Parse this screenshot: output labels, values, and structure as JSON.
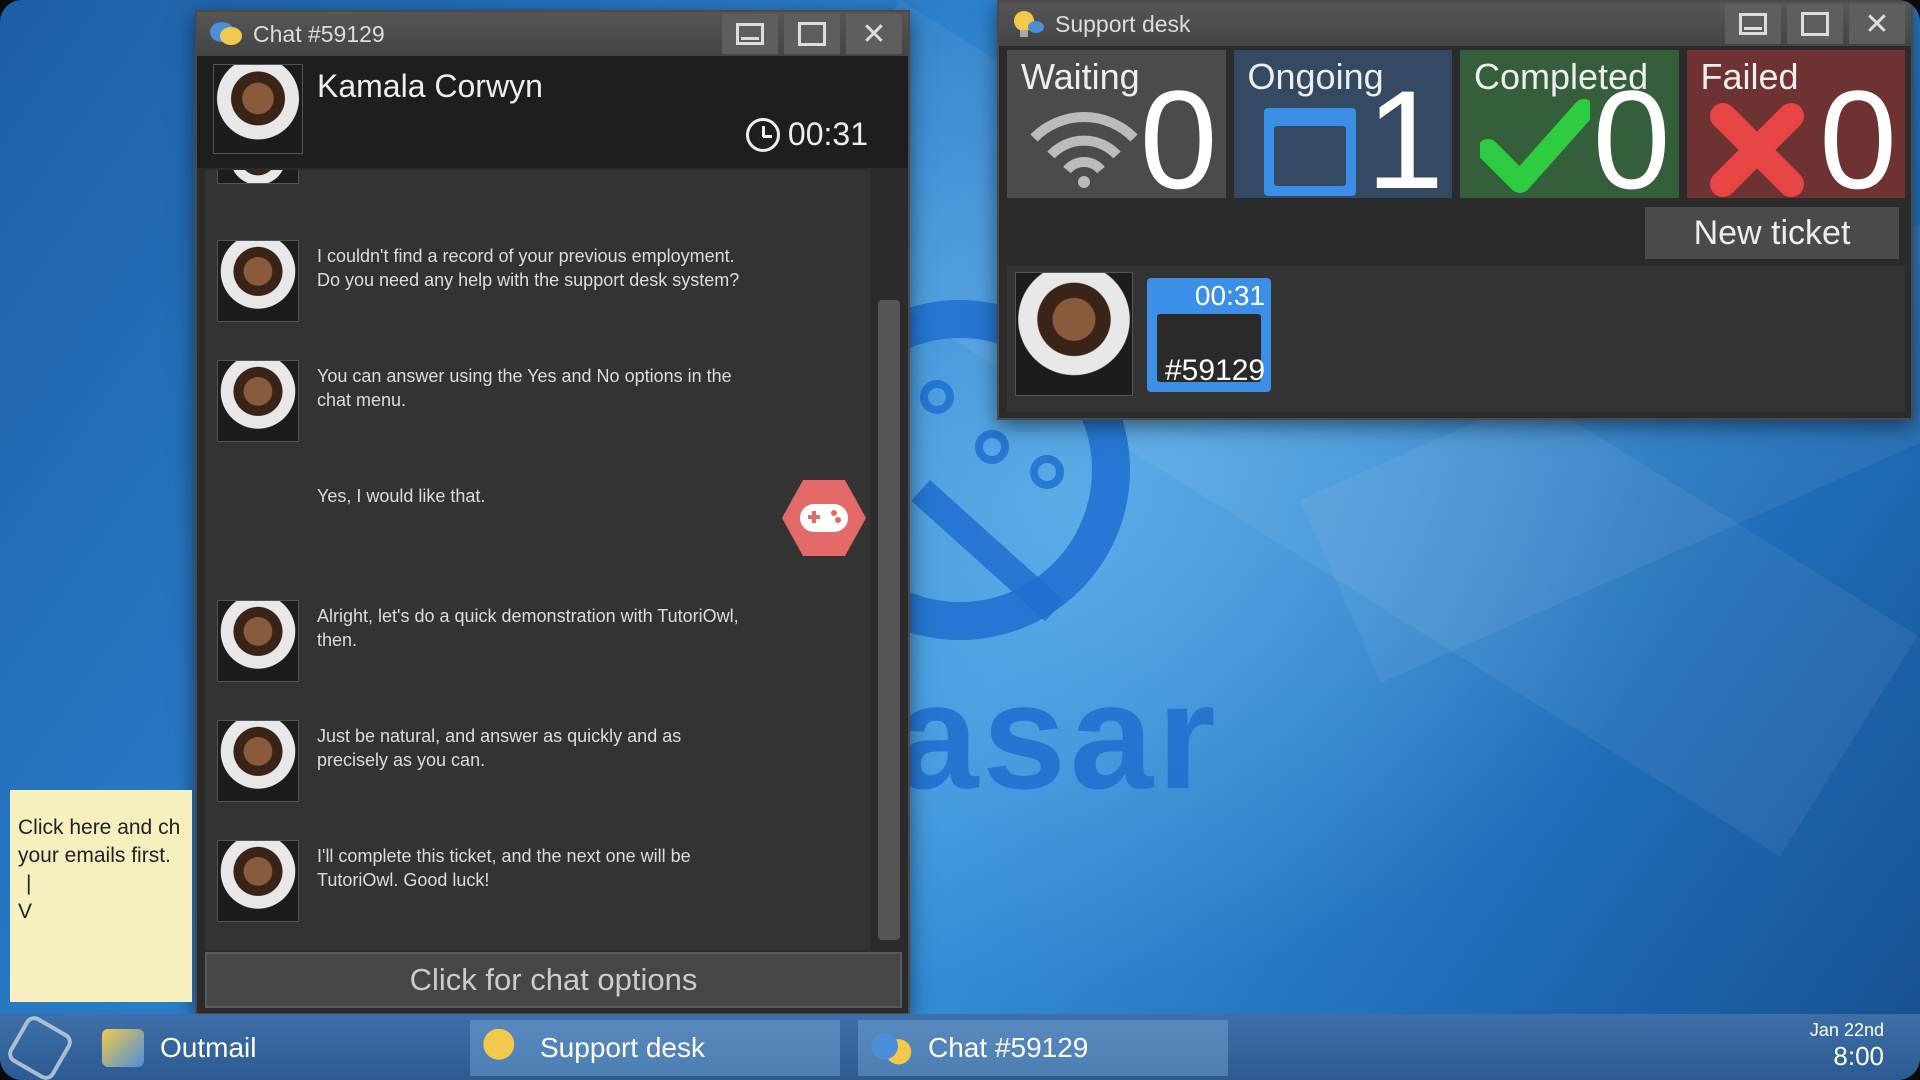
{
  "chat_window": {
    "title": "Chat #59129",
    "contact_name": "Kamala Corwyn",
    "timer": "00:31",
    "messages": [
      {
        "sender": "agent",
        "text": "I couldn't find a record of your previous employment. Do you need any help with the support desk system?"
      },
      {
        "sender": "agent",
        "text": "You can answer using the Yes and No options in the chat menu."
      },
      {
        "sender": "user",
        "text": "Yes, I would like that."
      },
      {
        "sender": "agent",
        "text": "Alright, let's do a quick demonstration with TutoriOwl, then."
      },
      {
        "sender": "agent",
        "text": "Just be natural, and answer as quickly and as precisely as you can."
      },
      {
        "sender": "agent",
        "text": "I'll complete this ticket, and the next one will be TutoriOwl. Good luck!"
      }
    ],
    "options_button": "Click for chat options"
  },
  "support_desk": {
    "title": "Support desk",
    "stats": {
      "waiting": {
        "label": "Waiting",
        "count": "0"
      },
      "ongoing": {
        "label": "Ongoing",
        "count": "1"
      },
      "completed": {
        "label": "Completed",
        "count": "0"
      },
      "failed": {
        "label": "Failed",
        "count": "0"
      }
    },
    "new_ticket_button": "New ticket",
    "tickets": [
      {
        "time": "00:31",
        "id": "#59129"
      }
    ]
  },
  "sticky_note": {
    "lines": [
      "Click here and ch",
      "your emails first.",
      "|",
      "V"
    ]
  },
  "taskbar": {
    "items": [
      {
        "label": "Outmail",
        "active": false
      },
      {
        "label": "Support desk",
        "active": true
      },
      {
        "label": "Chat #59129",
        "active": true
      }
    ],
    "date": "Jan 22nd",
    "time": "8:00"
  },
  "background": {
    "logo_text": "asar"
  },
  "colors": {
    "accent_blue": "#3b8fe6",
    "waiting": "#4b4b4b",
    "ongoing": "#344a62",
    "completed": "#355e3a",
    "failed": "#6e3232",
    "check_green": "#2ecc40",
    "cross_red": "#e84545"
  }
}
